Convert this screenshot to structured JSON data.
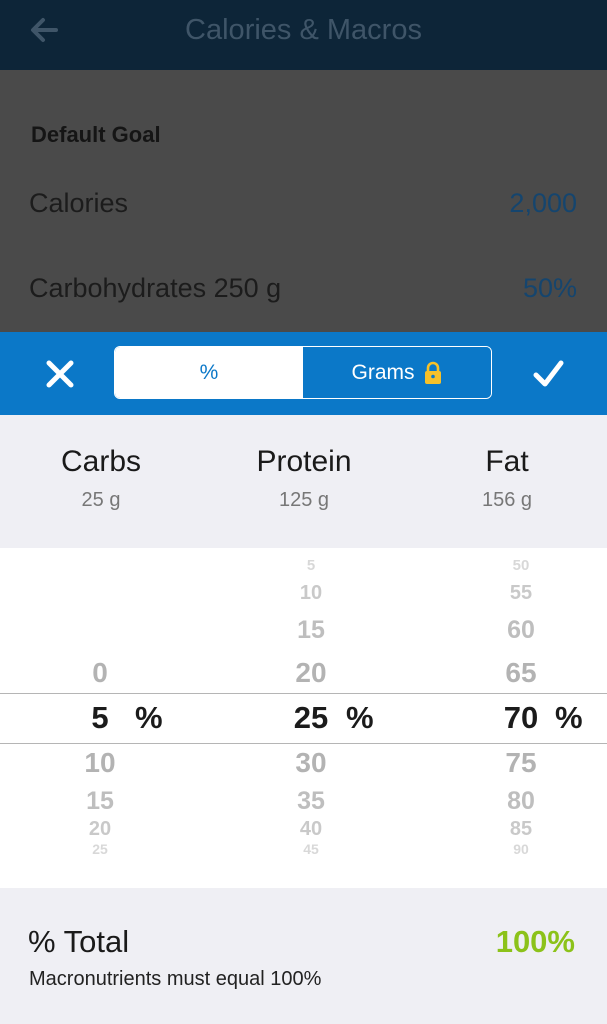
{
  "header": {
    "title": "Calories & Macros",
    "back_icon": "back-arrow-icon"
  },
  "settings": {
    "section_title": "Default Goal",
    "rows": [
      {
        "label": "Calories",
        "extra": "",
        "value": "2,000"
      },
      {
        "label": "Carbohydrates",
        "extra": "250 g",
        "value": "50%"
      }
    ]
  },
  "toolbar": {
    "close_icon": "close-x-icon",
    "confirm_icon": "checkmark-icon",
    "segments": [
      {
        "label": "%",
        "active": true
      },
      {
        "label": "Grams",
        "active": false,
        "icon": "lock-icon"
      }
    ]
  },
  "macros": [
    {
      "name": "Carbs",
      "grams": "25 g"
    },
    {
      "name": "Protein",
      "grams": "125 g"
    },
    {
      "name": "Fat",
      "grams": "156 g"
    }
  ],
  "picker": {
    "unit": "%",
    "columns": [
      {
        "name": "carbs",
        "selected": "5",
        "above": [
          "0"
        ],
        "below": [
          "10",
          "15",
          "20",
          "25"
        ]
      },
      {
        "name": "protein",
        "selected": "25",
        "above": [
          "5",
          "10",
          "15",
          "20"
        ],
        "below": [
          "30",
          "35",
          "40",
          "45"
        ]
      },
      {
        "name": "fat",
        "selected": "70",
        "above": [
          "50",
          "55",
          "60",
          "65"
        ],
        "below": [
          "75",
          "80",
          "85",
          "90"
        ]
      }
    ]
  },
  "total": {
    "label": "% Total",
    "value": "100%",
    "note": "Macronutrients must equal 100%",
    "value_color": "#8cc21a"
  },
  "colors": {
    "accent": "#0b78c8",
    "header": "#0d2538",
    "link_value": "#15456e"
  }
}
